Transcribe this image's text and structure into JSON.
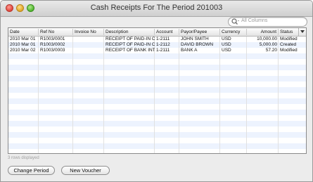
{
  "window": {
    "title": "Cash Receipts For The Period 201003"
  },
  "search": {
    "placeholder": "All Columns"
  },
  "table": {
    "columns": [
      "Date",
      "Ref No",
      "Invoice No",
      "Description",
      "Account",
      "Payor/Payee",
      "Currency",
      "Amount",
      "Status"
    ],
    "rows": [
      [
        "2010 Mar 01",
        "R1003/0001",
        "",
        "RECEIPT OF PAID-IN CAPI",
        "1-2111",
        "JOHN SMITH",
        "USD",
        "10,000.00",
        "Modified"
      ],
      [
        "2010 Mar 01",
        "R1003/0002",
        "",
        "RECEIPT OF PAID-IN CAPI",
        "1-2112",
        "DAVID BROWN",
        "USD",
        "5,000.00",
        "Created"
      ],
      [
        "2010 Mar 02",
        "R1003/0003",
        "",
        "RECEIPT OF BANK INTERE",
        "1-2111",
        "BANK A",
        "USD",
        "57.20",
        "Modified"
      ]
    ]
  },
  "status": {
    "rows_displayed": "3 rows displayed"
  },
  "buttons": {
    "change_period": "Change Period",
    "new_voucher": "New Voucher"
  },
  "colors": {
    "stripe": "#edf3fe",
    "window_bg": "#ececec"
  }
}
